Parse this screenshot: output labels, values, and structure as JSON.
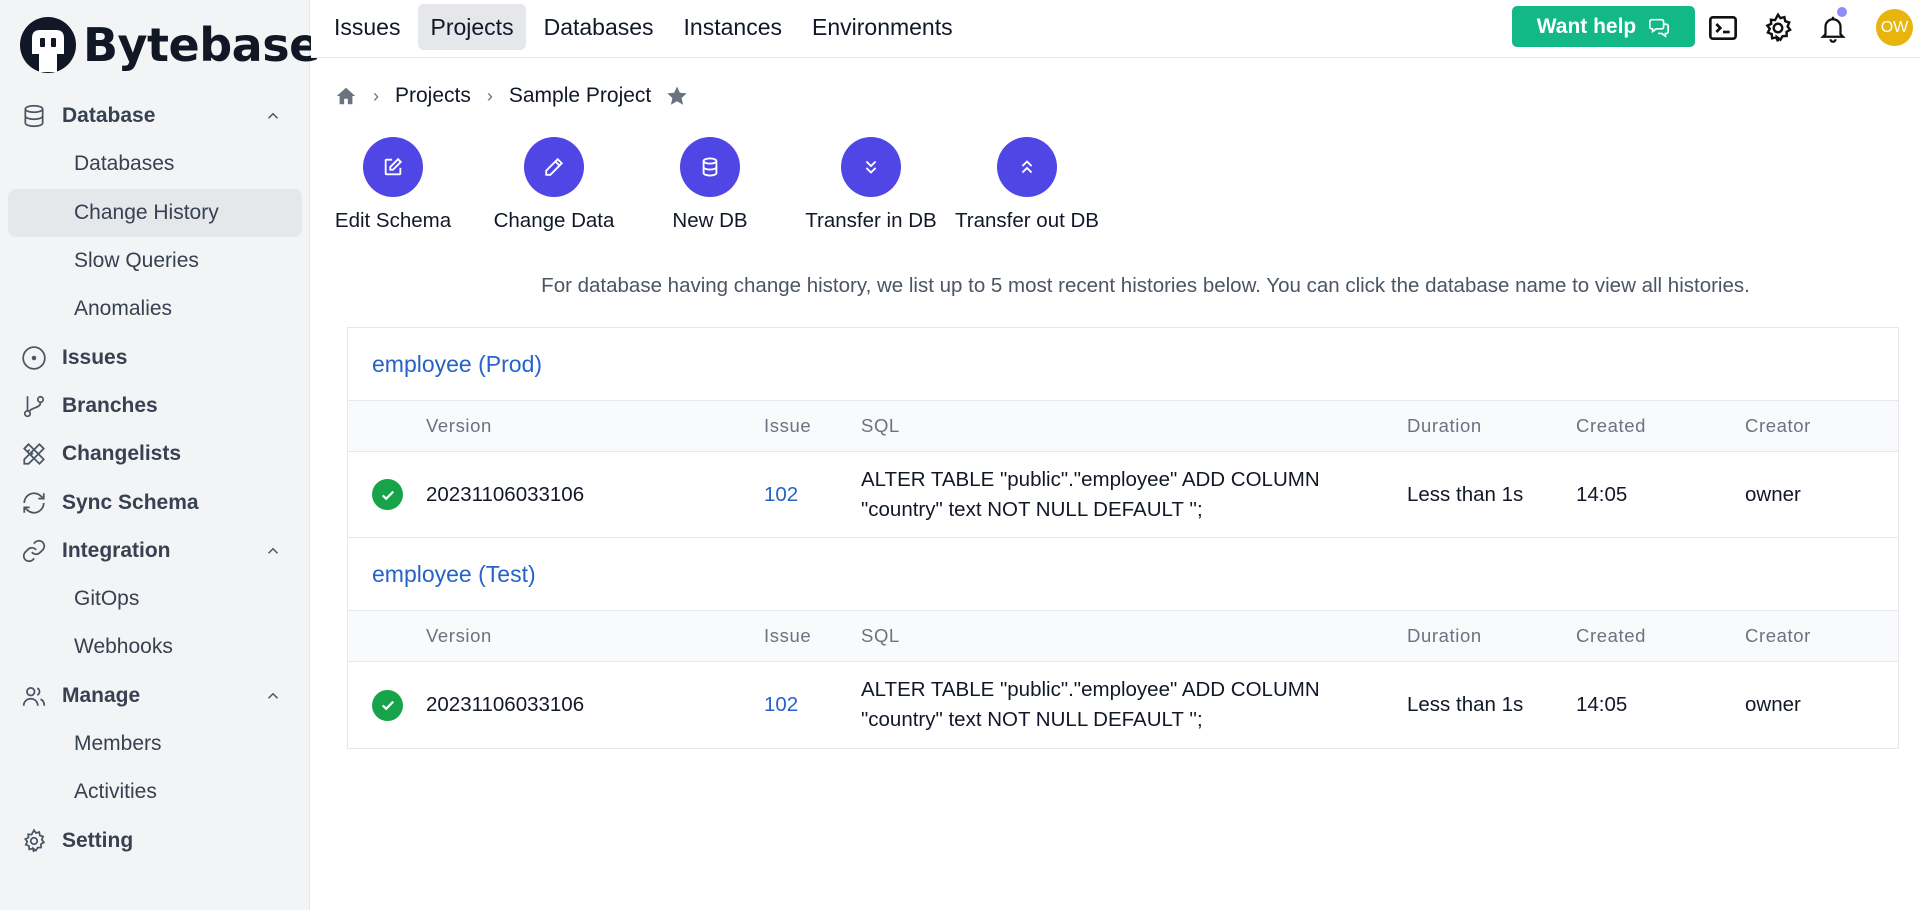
{
  "brand": {
    "name": "Bytebase"
  },
  "sidebar": {
    "groups": [
      {
        "label": "Database",
        "icon": "database-icon",
        "expandable": true,
        "expanded": true,
        "children": [
          {
            "label": "Databases",
            "active": false
          },
          {
            "label": "Change History",
            "active": true
          },
          {
            "label": "Slow Queries",
            "active": false
          },
          {
            "label": "Anomalies",
            "active": false
          }
        ]
      },
      {
        "label": "Issues",
        "icon": "issue-circle-icon"
      },
      {
        "label": "Branches",
        "icon": "git-branch-icon"
      },
      {
        "label": "Changelists",
        "icon": "changelist-icon"
      },
      {
        "label": "Sync Schema",
        "icon": "sync-icon"
      },
      {
        "label": "Integration",
        "icon": "link-icon",
        "expandable": true,
        "expanded": true,
        "children": [
          {
            "label": "GitOps",
            "active": false
          },
          {
            "label": "Webhooks",
            "active": false
          }
        ]
      },
      {
        "label": "Manage",
        "icon": "users-icon",
        "expandable": true,
        "expanded": true,
        "children": [
          {
            "label": "Members",
            "active": false
          },
          {
            "label": "Activities",
            "active": false
          }
        ]
      },
      {
        "label": "Setting",
        "icon": "gear-icon"
      }
    ]
  },
  "topnav": {
    "tabs": [
      {
        "label": "Issues",
        "active": false
      },
      {
        "label": "Projects",
        "active": true
      },
      {
        "label": "Databases",
        "active": false
      },
      {
        "label": "Instances",
        "active": false
      },
      {
        "label": "Environments",
        "active": false
      }
    ],
    "help_label": "Want help",
    "avatar_initials": "OW",
    "colors": {
      "help_button": "#12b886",
      "avatar": "#e8b40e",
      "notification_dot": "#8b8ef8"
    }
  },
  "breadcrumb": {
    "items": [
      "Projects",
      "Sample Project"
    ],
    "starred": true
  },
  "actions": [
    {
      "label": "Edit Schema",
      "icon": "edit-schema-icon"
    },
    {
      "label": "Change Data",
      "icon": "pencil-icon"
    },
    {
      "label": "New DB",
      "icon": "database-icon"
    },
    {
      "label": "Transfer in DB",
      "icon": "chevrons-down-icon"
    },
    {
      "label": "Transfer out DB",
      "icon": "chevrons-up-icon"
    }
  ],
  "accent_color": "#4f46e5",
  "notice": "For database having change history, we list up to 5 most recent histories below. You can click the database name to view all histories.",
  "columns": [
    "Version",
    "Issue",
    "SQL",
    "Duration",
    "Created",
    "Creator"
  ],
  "histories": [
    {
      "database": "employee (Prod)",
      "rows": [
        {
          "status": "done",
          "version": "20231106033106",
          "issue": "102",
          "sql_line1": "ALTER TABLE \"public\".\"employee\" ADD COLUMN",
          "sql_line2": "\"country\" text NOT NULL DEFAULT '';",
          "duration": "Less than 1s",
          "created": "14:05",
          "creator": "owner"
        }
      ]
    },
    {
      "database": "employee (Test)",
      "rows": [
        {
          "status": "done",
          "version": "20231106033106",
          "issue": "102",
          "sql_line1": "ALTER TABLE \"public\".\"employee\" ADD COLUMN",
          "sql_line2": "\"country\" text NOT NULL DEFAULT '';",
          "duration": "Less than 1s",
          "created": "14:05",
          "creator": "owner"
        }
      ]
    }
  ]
}
